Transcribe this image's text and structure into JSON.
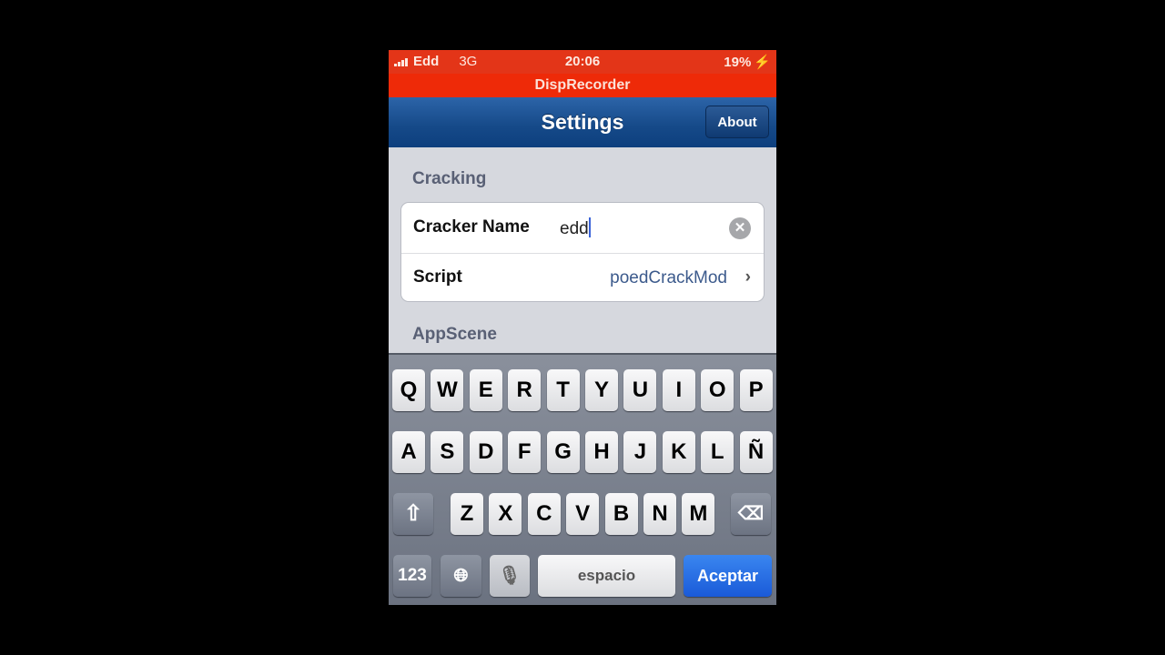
{
  "status_bar": {
    "carrier": "Edd",
    "network": "3G",
    "time": "20:06",
    "battery": "19%"
  },
  "recorder_banner": "DispRecorder",
  "nav": {
    "title": "Settings",
    "about_label": "About"
  },
  "sections": [
    {
      "header": "Cracking",
      "rows": [
        {
          "label": "Cracker Name",
          "value": "edd"
        },
        {
          "label": "Script",
          "value": "poedCrackMod"
        }
      ]
    },
    {
      "header": "AppScene"
    }
  ],
  "keyboard": {
    "row1": [
      "Q",
      "W",
      "E",
      "R",
      "T",
      "Y",
      "U",
      "I",
      "O",
      "P"
    ],
    "row2": [
      "A",
      "S",
      "D",
      "F",
      "G",
      "H",
      "J",
      "K",
      "L",
      "Ñ"
    ],
    "row3": [
      "Z",
      "X",
      "C",
      "V",
      "B",
      "N",
      "M"
    ],
    "numbers_label": "123",
    "space_label": "espacio",
    "return_label": "Aceptar"
  }
}
